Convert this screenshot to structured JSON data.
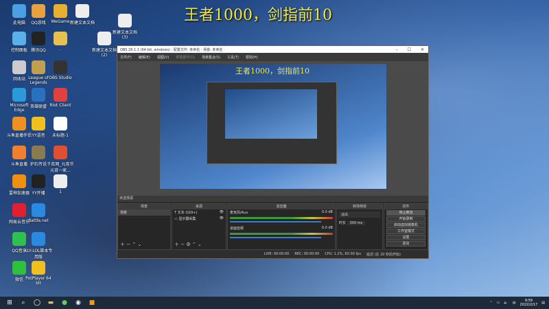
{
  "headline": "王者1000，剑指前10",
  "desktop_icons": [
    {
      "label": "此电脑",
      "color": "#4aa0e0"
    },
    {
      "label": "QQ游戏",
      "color": "#e8a040"
    },
    {
      "label": "WeGame",
      "color": "#e8b030"
    },
    {
      "label": "新建文本文档",
      "color": "#eeeeee"
    },
    {
      "label": "新建文本文档 (3)",
      "color": "#eeeeee"
    },
    {
      "label": "控制面板",
      "color": "#5ab0e8"
    },
    {
      "label": "腾讯QQ",
      "color": "#222222"
    },
    {
      "label": ".",
      "color": "#e8c050"
    },
    {
      "label": "新建文本文档 (2)",
      "color": "#eeeeee"
    },
    {
      "label": "回收站",
      "color": "#cccccc"
    },
    {
      "label": "League of Legends",
      "color": "#c0a050"
    },
    {
      "label": "OBS Studio",
      "color": "#333333"
    },
    {
      "label": "Microsoft Edge",
      "color": "#2a9ad8"
    },
    {
      "label": "英雄联盟",
      "color": "#2a70c0"
    },
    {
      "label": "Riot Client",
      "color": "#e04040"
    },
    {
      "label": "斗鱼直播伴侣",
      "color": "#f09020"
    },
    {
      "label": "YY语音",
      "color": "#f0c020"
    },
    {
      "label": "未标题-1",
      "color": "#ffffff"
    },
    {
      "label": "斗鱼直播",
      "color": "#f08030"
    },
    {
      "label": "炉石传说",
      "color": "#8a7a50"
    },
    {
      "label": "千库网_元宵节元宵一家...",
      "color": "#e05030"
    },
    {
      "label": "雷神加速器",
      "color": "#f09010"
    },
    {
      "label": "YY开播",
      "color": "#222222"
    },
    {
      "label": "1",
      "color": "#eeeeee"
    },
    {
      "label": "网易云音乐",
      "color": "#e02030"
    },
    {
      "label": "Battle.net",
      "color": "#2a8ae0"
    },
    {
      "label": "QQ音乐",
      "color": "#30c050"
    },
    {
      "label": "KLY-LOL脚本专用版",
      "color": "#2a8ae0"
    },
    {
      "label": "微信",
      "color": "#30c040"
    },
    {
      "label": "PotPlayer 64 bit",
      "color": "#f0c020"
    }
  ],
  "obs": {
    "title": "OBS 26.1.1 (64-bit, windows) - 配置文件: 未命名 - 场景: 未命名",
    "menu": [
      "文件(F)",
      "编辑(E)",
      "视图(V)",
      "停靠部件(D)",
      "场景集合(S)",
      "工具(T)",
      "帮助(H)"
    ],
    "preview_text": "王者1000，剑指前10",
    "source_bar": "未选择源",
    "docks": {
      "scenes": {
        "title": "场景",
        "items": [
          "场景"
        ]
      },
      "sources": {
        "title": "来源",
        "items": [
          "文本 (GDI+)",
          "显示器采集"
        ]
      },
      "mixer": {
        "title": "混音器",
        "channels": [
          {
            "name": "麦克风/Aux",
            "db": "0.0 dB"
          },
          {
            "name": "桌面音频",
            "db": "0.0 dB"
          }
        ]
      },
      "transitions": {
        "title": "转场特效",
        "type": "淡出",
        "duration_label": "时长",
        "duration": "300 ms"
      },
      "controls": {
        "title": "控件",
        "buttons": [
          "停止推流",
          "开始录制",
          "启动虚拟摄像机",
          "工作室模式",
          "设置",
          "退出"
        ]
      }
    },
    "status": {
      "live": "LIVE: 00:00:00",
      "rec": "REC: 00:00:00",
      "cpu": "CPU: 1.2%, 60.00 fps",
      "delay": "延迟 (在 20 秒后开始)"
    }
  },
  "taskbar": {
    "time": "9:59",
    "date": "2022/2/17",
    "ime": "中"
  }
}
